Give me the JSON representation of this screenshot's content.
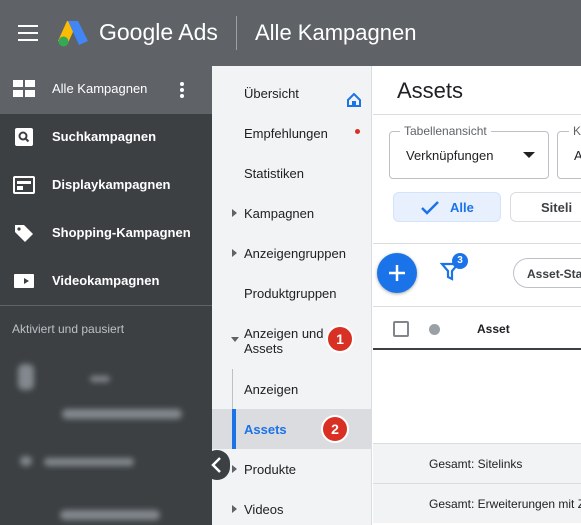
{
  "topbar": {
    "brand": "Google Ads",
    "page_title": "Alle Kampagnen"
  },
  "sidebar": {
    "items": [
      {
        "label": "Alle Kampagnen",
        "icon": "dashboard-icon"
      },
      {
        "label": "Suchkampagnen",
        "icon": "search-icon"
      },
      {
        "label": "Displaykampagnen",
        "icon": "display-icon"
      },
      {
        "label": "Shopping-Kampagnen",
        "icon": "tag-icon"
      },
      {
        "label": "Videokampagnen",
        "icon": "video-icon"
      }
    ],
    "section_label": "Aktiviert und pausiert"
  },
  "nav": {
    "items": [
      {
        "label": "Übersicht"
      },
      {
        "label": "Empfehlungen"
      },
      {
        "label": "Statistiken"
      },
      {
        "label": "Kampagnen"
      },
      {
        "label": "Anzeigengruppen"
      },
      {
        "label": "Produktgruppen"
      },
      {
        "label": "Anzeigen und Assets"
      },
      {
        "label": "Anzeigen"
      },
      {
        "label": "Assets"
      },
      {
        "label": "Produkte"
      },
      {
        "label": "Videos"
      }
    ],
    "badge_1": "1",
    "badge_2": "2"
  },
  "main": {
    "title": "Assets",
    "table_view": {
      "legend": "Tabellenansicht",
      "value": "Verknüpfungen"
    },
    "second_select": {
      "legend": "K",
      "value": "A"
    },
    "chips": {
      "all": "Alle",
      "sitelinks": "Siteli"
    },
    "filter_count": "3",
    "filter_chip": "Asset-Sta",
    "table_header": {
      "asset": "Asset"
    },
    "summary_rows": [
      "Gesamt: Sitelinks",
      "Gesamt: Erweiterungen mit Z"
    ]
  },
  "colors": {
    "topbar": "#5f6368",
    "sidebar": "#3c4043",
    "accent": "#1a73e8",
    "badge": "#d93025"
  }
}
